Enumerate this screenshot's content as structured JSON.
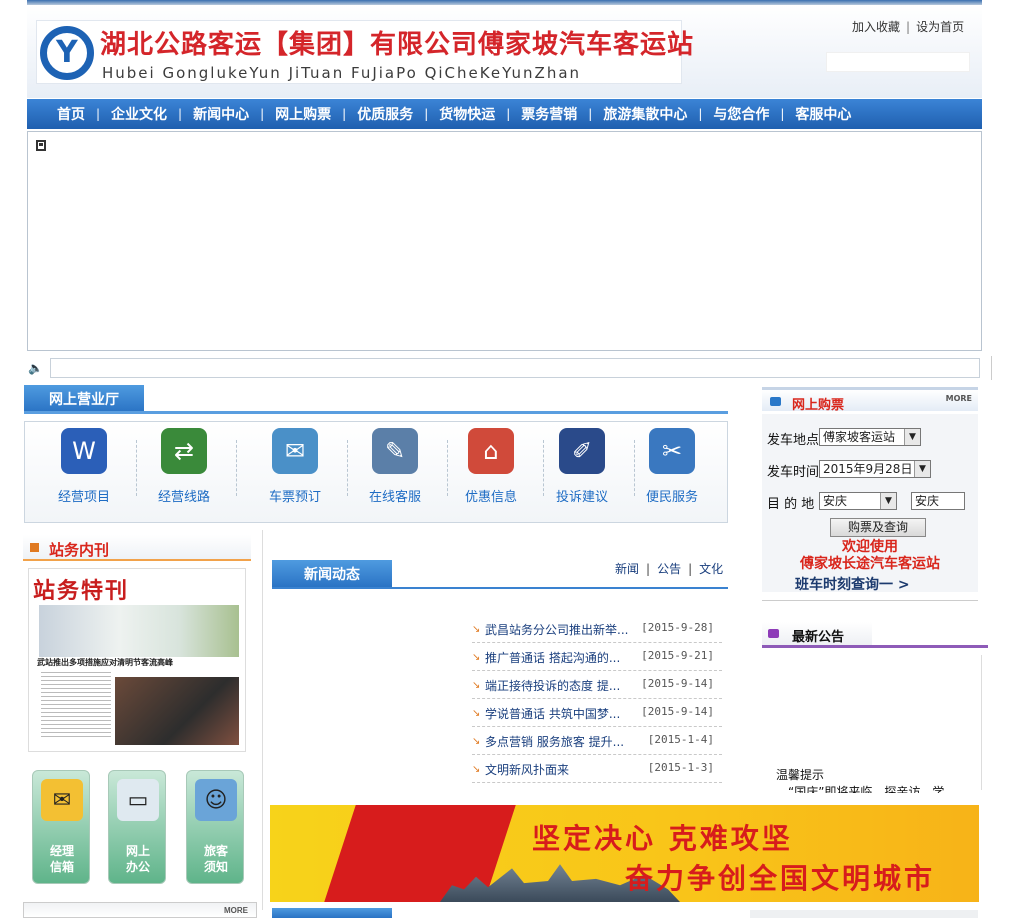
{
  "header": {
    "title": "湖北公路客运【集团】有限公司傅家坡汽车客运站",
    "pinyin": "Hubei GonglukeYun JiTuan FuJiaPo QiCheKeYunZhan",
    "links": {
      "bookmark": "加入收藏",
      "homepage": "设为首页"
    }
  },
  "nav": {
    "items": [
      "首页",
      "企业文化",
      "新闻中心",
      "网上购票",
      "优质服务",
      "货物快运",
      "票务营销",
      "旅游集散中心",
      "与您合作",
      "客服中心"
    ]
  },
  "hall": {
    "title": "网上营业厅",
    "services": [
      {
        "label": "经营项目",
        "icon": "word-document-icon",
        "color": "#2b5fb8"
      },
      {
        "label": "经营线路",
        "icon": "network-route-icon",
        "color": "#3a8a3a"
      },
      {
        "label": "车票预订",
        "icon": "ticket-envelope-icon",
        "color": "#4a90c8"
      },
      {
        "label": "在线客服",
        "icon": "pen-pencil-icon",
        "color": "#5b7fa8"
      },
      {
        "label": "优惠信息",
        "icon": "globe-house-icon",
        "color": "#d04a3a"
      },
      {
        "label": "投诉建议",
        "icon": "stylus-icon",
        "color": "#2a4a8a"
      },
      {
        "label": "便民服务",
        "icon": "basket-tools-icon",
        "color": "#3a78c0"
      }
    ]
  },
  "ticket": {
    "title": "网上购票",
    "more": "MORE",
    "depart_label": "发车地点",
    "depart_value": "傅家坡客运站",
    "time_label": "发车时间",
    "time_value": "2015年9月28日",
    "dest_label": "目 的 地",
    "dest_value": "安庆",
    "dest_input": "安庆",
    "query_button": "购票及查询",
    "welcome_line1": "欢迎使用",
    "welcome_line2": "傅家坡长途汽车客运站",
    "schedule_link": "班车时刻查询一 >"
  },
  "announcement": {
    "title": "最新公告",
    "heading": "温馨提示",
    "text": "“国庆”即将来临，探亲访、学"
  },
  "magazine": {
    "title": "站务内刊",
    "cover_title": "站务特刊",
    "cover_headline": "武站推出多项措施应对清明节客流高峰"
  },
  "quick_links": [
    {
      "label_line1": "经理",
      "label_line2": "信箱",
      "icon": "mail-envelope-icon"
    },
    {
      "label_line1": "网上",
      "label_line2": "办公",
      "icon": "monitor-icon"
    },
    {
      "label_line1": "旅客",
      "label_line2": "须知",
      "icon": "people-icon"
    }
  ],
  "news": {
    "title": "新闻动态",
    "categories": [
      "新闻",
      "公告",
      "文化"
    ],
    "items": [
      {
        "title": "武昌站务分公司推出新举...",
        "date": "[2015-9-28]"
      },
      {
        "title": "推广普通话 搭起沟通的...",
        "date": "[2015-9-21]"
      },
      {
        "title": "端正接待投诉的态度 提...",
        "date": "[2015-9-14]"
      },
      {
        "title": "学说普通话 共筑中国梦...",
        "date": "[2015-9-14]"
      },
      {
        "title": "多点营销 服务旅客 提升...",
        "date": "[2015-1-4]"
      },
      {
        "title": "文明新风扑面来",
        "date": "[2015-1-3]"
      }
    ]
  },
  "banner": {
    "line1": "坚定决心 克难攻坚",
    "line2": "奋力争创全国文明城市"
  },
  "bottom": {
    "more": "MORE"
  }
}
